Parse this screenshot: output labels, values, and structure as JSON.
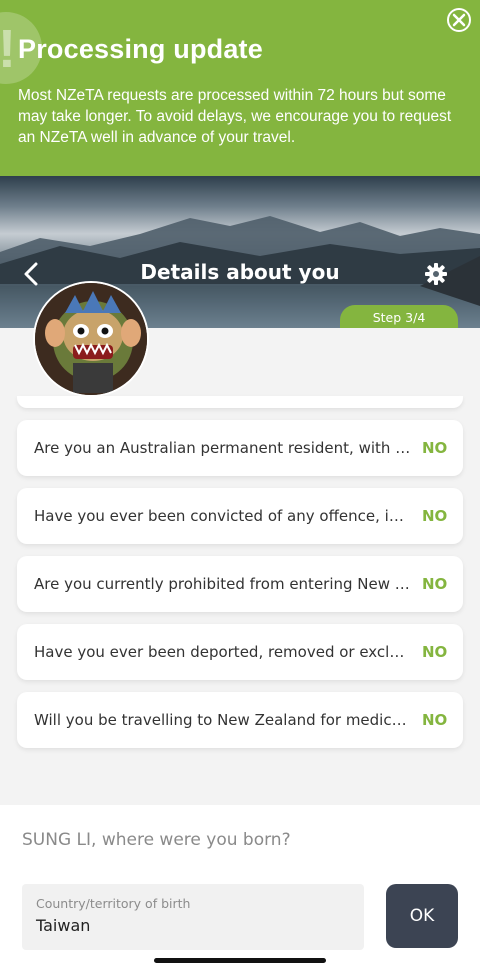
{
  "banner": {
    "title": "Processing update",
    "body": "Most NZeTA requests are processed within 72 hours but some may take longer. To avoid delays, we encourage you to request an NZeTA well in advance of your travel.",
    "bang": "!",
    "close_icon": "close-circle-icon",
    "color": "#84b53f"
  },
  "header": {
    "title": "Details about you",
    "back_icon": "chevron-left-icon",
    "settings_icon": "gear-icon",
    "step": "Step 3/4"
  },
  "questions": [
    {
      "text": "Are you an Australian permanent resident, with a current resident return visa?",
      "answer": "NO"
    },
    {
      "text": "Have you ever been convicted of any offence, in any country?",
      "answer": "NO"
    },
    {
      "text": "Are you currently prohibited from entering New Zealand?",
      "answer": "NO"
    },
    {
      "text": "Have you ever been deported, removed or excluded from any country?",
      "answer": "NO"
    },
    {
      "text": "Will you be travelling to New Zealand for medical treatment?",
      "answer": "NO"
    }
  ],
  "form": {
    "prompt": "SUNG LI, where were you born?",
    "field_label": "Country/territory of birth",
    "field_value": "Taiwan",
    "ok_label": "OK"
  },
  "colors": {
    "accent": "#84b53f",
    "ok_button": "#3c4453"
  }
}
